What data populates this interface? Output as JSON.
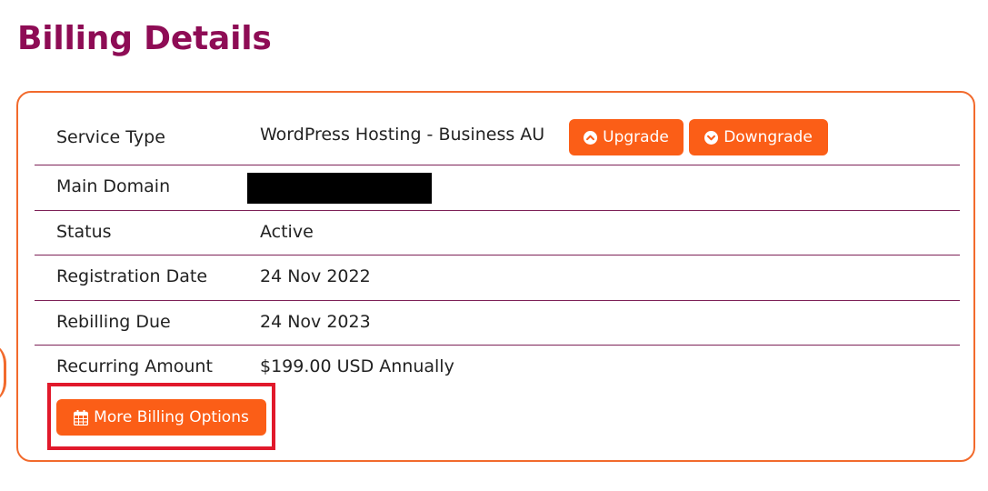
{
  "page": {
    "title": "Billing Details"
  },
  "details": {
    "service_type": {
      "label": "Service Type",
      "value": "WordPress Hosting - Business AU"
    },
    "main_domain": {
      "label": "Main Domain",
      "value": ""
    },
    "status": {
      "label": "Status",
      "value": "Active"
    },
    "registration_date": {
      "label": "Registration Date",
      "value": "24 Nov 2022"
    },
    "rebilling_due": {
      "label": "Rebilling Due",
      "value": "24 Nov 2023"
    },
    "recurring_amount": {
      "label": "Recurring Amount",
      "value": "$199.00 USD Annually"
    }
  },
  "actions": {
    "upgrade_label": "Upgrade",
    "downgrade_label": "Downgrade",
    "more_billing_label": "More Billing Options"
  },
  "icons": {
    "upgrade": "chevron-up-circle-icon",
    "downgrade": "chevron-down-circle-icon",
    "more_billing": "calendar-icon"
  },
  "colors": {
    "title": "#8e0c55",
    "accent": "#fb5e17",
    "card_border": "#f26a2c",
    "divider": "#7d2157",
    "highlight": "#e1192b"
  }
}
